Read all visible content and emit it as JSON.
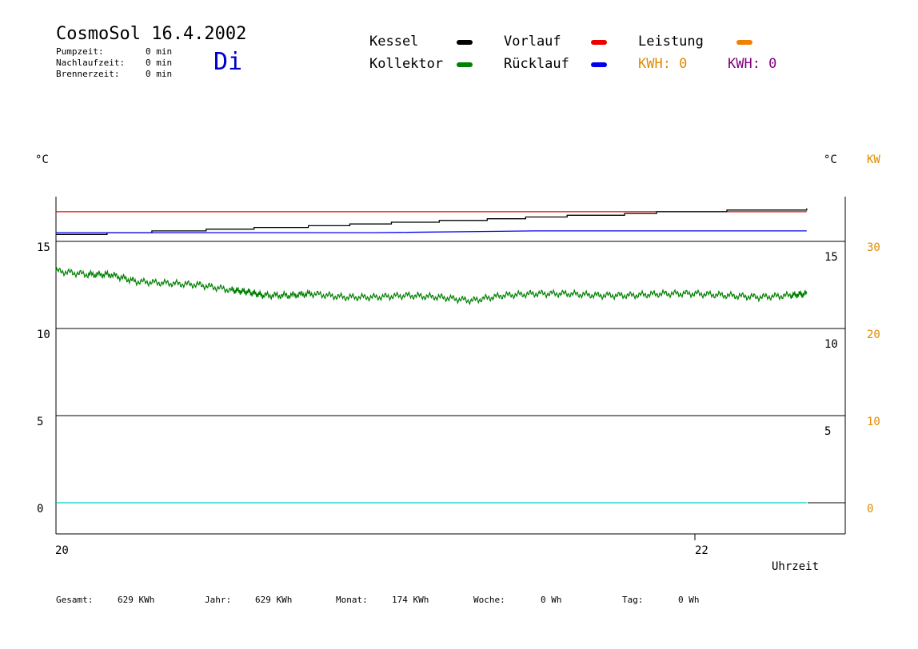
{
  "header": {
    "title": "CosmoSol 16.4.2002",
    "day": "Di",
    "stats": [
      {
        "label": "Pumpzeit:",
        "value": "0 min"
      },
      {
        "label": "Nachlaufzeit:",
        "value": "0 min"
      },
      {
        "label": "Brennerzeit:",
        "value": "0 min"
      }
    ]
  },
  "legend": {
    "items": [
      {
        "label": "Kessel",
        "color": "#000000"
      },
      {
        "label": "Kollektor",
        "color": "#008000"
      },
      {
        "label": "Vorlauf",
        "color": "#ee0000"
      },
      {
        "label": "Rücklauf",
        "color": "#0000ee"
      },
      {
        "label": "Leistung",
        "color": "#f08000"
      }
    ],
    "kwh_1": "KWH: 0",
    "kwh_2": "KWH: 0"
  },
  "axes": {
    "left_unit": "°C",
    "right_unit": "°C",
    "kw_unit": "KW",
    "xlabel": "Uhrzeit"
  },
  "footer": {
    "items": [
      {
        "label": "Gesamt:",
        "value": "629 KWh"
      },
      {
        "label": "Jahr:",
        "value": "629 KWh"
      },
      {
        "label": "Monat:",
        "value": "174 KWh"
      },
      {
        "label": "Woche:",
        "value": "0 Wh"
      },
      {
        "label": "Tag:",
        "value": "0 Wh"
      }
    ]
  },
  "chart_data": {
    "type": "line",
    "xlabel": "Uhrzeit",
    "x_ticks": [
      "20",
      "22"
    ],
    "xlim": [
      20.0,
      22.47
    ],
    "ylim": [
      -1.8,
      19.2
    ],
    "y_ticks_left": [
      "15",
      "10",
      "5",
      "0"
    ],
    "y_ticks_right": [
      "15",
      "10",
      "5"
    ],
    "y_ticks_kw": [
      "30",
      "20",
      "10",
      "0"
    ],
    "series": [
      {
        "name": "Vorlauf",
        "color": "#ee0000",
        "x": [
          20.0,
          21.0,
          21.5,
          22.0,
          22.35
        ],
        "y": [
          16.7,
          16.7,
          16.7,
          16.7,
          16.7
        ]
      },
      {
        "name": "Kessel",
        "color": "#000000",
        "x": [
          20.0,
          20.04,
          20.16,
          20.3,
          20.47,
          20.62,
          20.79,
          20.92,
          21.05,
          21.2,
          21.35,
          21.47,
          21.6,
          21.78,
          21.88,
          22.1,
          22.23,
          22.35
        ],
        "y": [
          15.4,
          15.4,
          15.5,
          15.6,
          15.7,
          15.8,
          15.9,
          16.0,
          16.1,
          16.2,
          16.3,
          16.4,
          16.5,
          16.6,
          16.7,
          16.8,
          16.8,
          16.9
        ]
      },
      {
        "name": "Rücklauf",
        "color": "#0000ee",
        "x": [
          20.0,
          20.5,
          21.0,
          21.5,
          22.0,
          22.35
        ],
        "y": [
          15.5,
          15.5,
          15.5,
          15.6,
          15.6,
          15.6
        ]
      },
      {
        "name": "Kollektor",
        "color": "#008000",
        "x": [
          20.0,
          20.1,
          20.17,
          20.25,
          20.35,
          20.45,
          20.55,
          20.6,
          20.65,
          20.73,
          20.8,
          20.9,
          21.0,
          21.1,
          21.2,
          21.3,
          21.4,
          21.5,
          21.6,
          21.7,
          21.8,
          21.9,
          22.0,
          22.1,
          22.2,
          22.3,
          22.35
        ],
        "y": [
          13.3,
          13.1,
          13.1,
          12.7,
          12.6,
          12.5,
          12.2,
          12.1,
          11.9,
          11.9,
          12.0,
          11.8,
          11.8,
          11.9,
          11.8,
          11.6,
          11.9,
          12.0,
          12.0,
          11.9,
          11.9,
          12.0,
          12.0,
          11.9,
          11.8,
          11.9,
          12.0
        ]
      },
      {
        "name": "Leistung",
        "color": "#00cccc",
        "x": [
          20.0,
          22.35
        ],
        "y": [
          0.0,
          0.0
        ]
      }
    ]
  }
}
